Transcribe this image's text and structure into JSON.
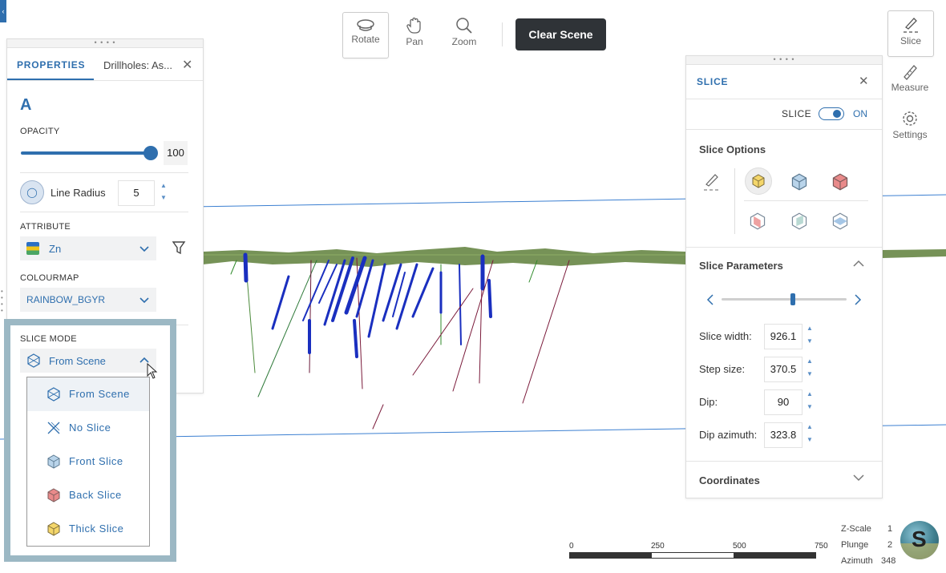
{
  "toolbar": {
    "rotate": "Rotate",
    "pan": "Pan",
    "zoom": "Zoom",
    "clear_scene": "Clear Scene"
  },
  "right_tools": {
    "slice": "Slice",
    "measure": "Measure",
    "settings": "Settings"
  },
  "properties": {
    "tab_title": "PROPERTIES",
    "tab_layer": "Drillholes: As...",
    "opacity_label": "OPACITY",
    "opacity_value": "100",
    "opacity_fraction": 1.0,
    "line_radius_label": "Line Radius",
    "line_radius_value": "5",
    "attribute_label": "ATTRIBUTE",
    "attribute_value": "Zn",
    "colourmap_label": "COLOURMAP",
    "colourmap_value": "RAINBOW_BGYR",
    "slice_mode_label": "SLICE MODE",
    "slice_mode_value": "From Scene"
  },
  "slice_mode_menu": [
    {
      "label": "From Scene",
      "icon": "from-scene-icon",
      "selected": true
    },
    {
      "label": "No Slice",
      "icon": "no-slice-icon",
      "selected": false
    },
    {
      "label": "Front Slice",
      "icon": "front-slice-icon",
      "selected": false
    },
    {
      "label": "Back Slice",
      "icon": "back-slice-icon",
      "selected": false
    },
    {
      "label": "Thick Slice",
      "icon": "thick-slice-icon",
      "selected": false
    }
  ],
  "slice_panel": {
    "title": "SLICE",
    "toggle_label": "SLICE",
    "toggle_state": "ON",
    "options_title": "Slice Options",
    "parameters_title": "Slice Parameters",
    "slider_position": 0.57,
    "slice_width_label": "Slice width:",
    "slice_width_value": "926.1",
    "step_size_label": "Step size:",
    "step_size_value": "370.5",
    "dip_label": "Dip:",
    "dip_value": "90",
    "dip_azimuth_label": "Dip azimuth:",
    "dip_azimuth_value": "323.8",
    "coordinates_title": "Coordinates"
  },
  "scale_bar": {
    "ticks": [
      "0",
      "250",
      "500",
      "750"
    ]
  },
  "view_info": {
    "zscale_label": "Z-Scale",
    "zscale_value": "1",
    "plunge_label": "Plunge",
    "plunge_value": "2",
    "azimuth_label": "Azimuth",
    "azimuth_value": "348",
    "compass_letter": "S"
  },
  "colors": {
    "accent": "#2f6fae",
    "dark_button": "#2f3337",
    "dropdown_frame": "#9cb8c4",
    "drillhole_blue": "#1a2fbf",
    "terrain_green": "#5e7f3a"
  }
}
